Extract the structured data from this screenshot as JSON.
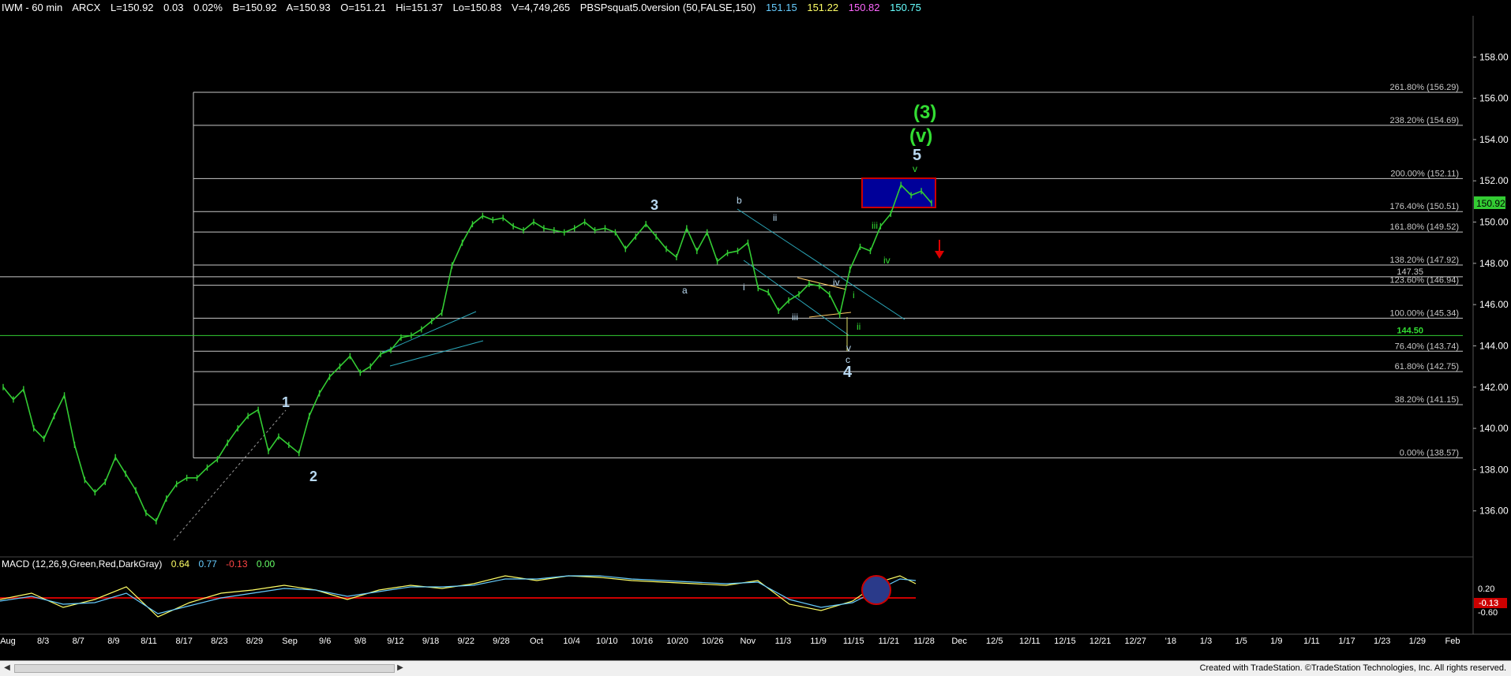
{
  "header": {
    "symbol": "IWM - 60 min",
    "exchange": "ARCX",
    "last": "L=150.92",
    "change": "0.03",
    "change_pct": "0.02%",
    "bid": "B=150.92",
    "ask": "A=150.93",
    "open": "O=151.21",
    "high": "Hi=151.37",
    "low": "Lo=150.83",
    "volume": "V=4,749,265",
    "indicator": "PBSPsquat5.0version (50,FALSE,150)",
    "ind_values": [
      "151.15",
      "151.22",
      "150.82",
      "150.75"
    ],
    "ind_colors": [
      "#66ccff",
      "#ffff66",
      "#ff66ff",
      "#66ffff"
    ]
  },
  "macd": {
    "label": "MACD (12,26,9,Green,Red,DarkGray)",
    "values": [
      "0.64",
      "0.77",
      "-0.13",
      "0.00"
    ],
    "colors": [
      "#ffff66",
      "#66ccff",
      "#ff4444",
      "#66ff66"
    ],
    "axis_labels": [
      "0.20",
      "-0.13",
      "-0.60"
    ],
    "current_badge": "-0.13"
  },
  "footer": {
    "credit": "Created with TradeStation. ©TradeStation Technologies, Inc. All rights reserved."
  },
  "colors": {
    "background": "#000000",
    "up_bar": "#33cc33",
    "fib_line": "#c8c8c8",
    "fib_label": "#c8c8c8",
    "channel": "#2aa6b8",
    "wave_green": "#33dd33",
    "wave_blue": "#b8d8f0",
    "target_box": "#000099",
    "target_box_border": "#cc0000",
    "down_arrow": "#dd0000",
    "current_price_badge": "#33cc33"
  },
  "chart_data": {
    "type": "line",
    "title": "IWM - 60 min",
    "ylim": [
      134.0,
      160.0
    ],
    "y_ticks": [
      "158.00",
      "156.00",
      "154.00",
      "152.00",
      "150.00",
      "148.00",
      "146.00",
      "144.00",
      "142.00",
      "140.00",
      "138.00",
      "136.00"
    ],
    "x_ticks": [
      "Aug",
      "8/3",
      "8/7",
      "8/9",
      "8/11",
      "8/17",
      "8/23",
      "8/29",
      "Sep",
      "9/6",
      "9/8",
      "9/12",
      "9/18",
      "9/22",
      "9/28",
      "Oct",
      "10/4",
      "10/10",
      "10/16",
      "10/20",
      "10/26",
      "Nov",
      "11/3",
      "11/9",
      "11/15",
      "11/21",
      "11/28",
      "Dec",
      "12/5",
      "12/11",
      "12/15",
      "12/21",
      "12/27",
      "'18",
      "1/3",
      "1/5",
      "1/9",
      "1/11",
      "1/17",
      "1/23",
      "1/29",
      "Feb"
    ],
    "series": [
      {
        "name": "IWM",
        "values": [
          142.0,
          141.4,
          141.9,
          140.0,
          139.5,
          140.6,
          141.6,
          139.2,
          137.5,
          136.9,
          137.4,
          138.6,
          137.8,
          137.0,
          135.9,
          135.5,
          136.6,
          137.3,
          137.6,
          137.6,
          138.1,
          138.5,
          139.3,
          140.0,
          140.6,
          140.9,
          138.9,
          139.6,
          139.2,
          138.8,
          140.6,
          141.7,
          142.5,
          143.0,
          143.5,
          142.7,
          143.0,
          143.6,
          143.8,
          144.4,
          144.5,
          144.8,
          145.2,
          145.6,
          147.9,
          149.0,
          149.9,
          150.3,
          150.1,
          150.2,
          149.8,
          149.6,
          150.0,
          149.7,
          149.6,
          149.5,
          149.7,
          150.0,
          149.6,
          149.7,
          149.5,
          148.7,
          149.3,
          149.9,
          149.3,
          148.7,
          148.3,
          149.7,
          148.6,
          149.5,
          148.1,
          148.5,
          148.6,
          149.0,
          146.8,
          146.6,
          145.7,
          146.2,
          146.5,
          147.0,
          146.9,
          146.5,
          145.5,
          147.7,
          148.8,
          148.6,
          149.8,
          150.4,
          151.8,
          151.3,
          151.5,
          150.92
        ]
      }
    ],
    "fib_levels": [
      {
        "label": "261.80%",
        "value": 156.29
      },
      {
        "label": "238.20%",
        "value": 154.69
      },
      {
        "label": "200.00%",
        "value": 152.11
      },
      {
        "label": "176.40%",
        "value": 150.51
      },
      {
        "label": "161.80%",
        "value": 149.52
      },
      {
        "label": "138.20%",
        "value": 147.92
      },
      {
        "label": "123.60%",
        "value": 146.94
      },
      {
        "label": "100.00%",
        "value": 145.34
      },
      {
        "label": "76.40%",
        "value": 143.74
      },
      {
        "label": "61.80%",
        "value": 142.75
      },
      {
        "label": "38.20%",
        "value": 141.15
      },
      {
        "label": "0.00%",
        "value": 138.57
      }
    ],
    "fib_level_texts": [
      "261.80% (156.29)",
      "238.20% (154.69)",
      "200.00% (152.11)",
      "176.40% (150.51)",
      "161.80% (149.52)",
      "138.20% (147.92)",
      "123.60% (146.94)",
      "100.00% (145.34)",
      "76.40% (143.74)",
      "61.80% (142.75)",
      "38.20% (141.15)",
      "0.00% (138.57)"
    ],
    "extra_levels": [
      {
        "label": "147.35",
        "value": 147.35
      },
      {
        "label": "144.50",
        "value": 144.5
      }
    ],
    "current_price": "150.92",
    "wave_labels": [
      "1",
      "2",
      "3",
      "4",
      "5",
      "(3)",
      "(v)",
      "a",
      "b",
      "c",
      "i",
      "ii",
      "iii",
      "iv",
      "v",
      "v"
    ]
  }
}
